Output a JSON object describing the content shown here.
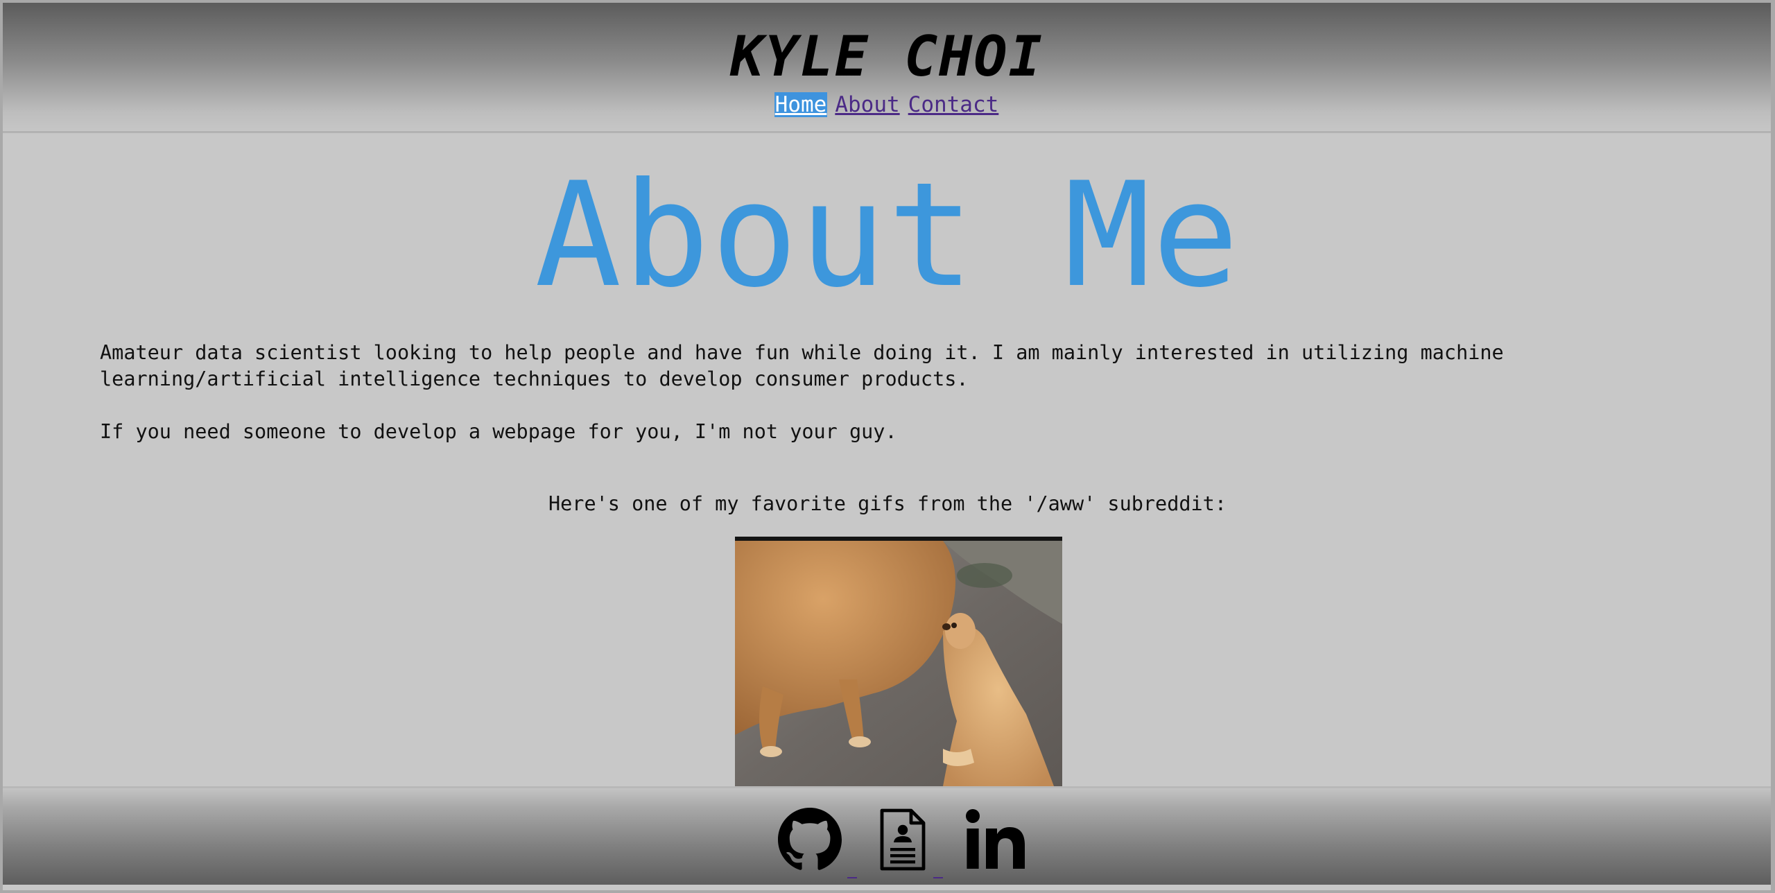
{
  "header": {
    "title": "KYLE CHOI",
    "nav": [
      {
        "label": "Home",
        "active": true
      },
      {
        "label": "About",
        "active": false
      },
      {
        "label": "Contact",
        "active": false
      }
    ]
  },
  "main": {
    "heading": "About Me",
    "bio_paragraph_1": "Amateur data scientist looking to help people and have fun while doing it. I am mainly interested in utilizing machine learning/artificial intelligence techniques to develop consumer products.",
    "bio_paragraph_2": "If you need someone to develop a webpage for you, I'm not your guy.",
    "gif_caption": "Here's one of my favorite gifs from the '/aww' subreddit:"
  },
  "footer": {
    "icons": [
      "github-icon",
      "resume-document-icon",
      "linkedin-icon"
    ]
  },
  "colors": {
    "page_background": "#c8c8c8",
    "heading": "#3d97dc",
    "nav_link": "#4b2a86",
    "nav_active_background": "#3e93de",
    "nav_active_text": "#ffffff"
  }
}
